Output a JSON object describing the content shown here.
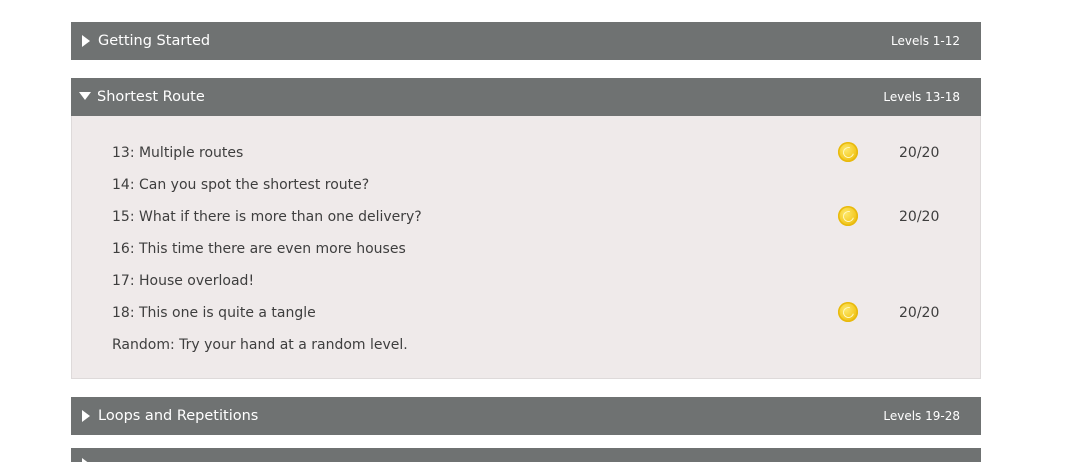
{
  "sections": [
    {
      "title": "Getting Started",
      "levels": "Levels 1-12",
      "expanded": false
    },
    {
      "title": "Shortest Route",
      "levels": "Levels 13-18",
      "expanded": true,
      "items": [
        {
          "name": "13: Multiple routes",
          "coin": true,
          "score": "20/20"
        },
        {
          "name": "14: Can you spot the shortest route?",
          "coin": false,
          "score": ""
        },
        {
          "name": "15: What if there is more than one delivery?",
          "coin": true,
          "score": "20/20"
        },
        {
          "name": "16: This time there are even more houses",
          "coin": false,
          "score": ""
        },
        {
          "name": "17: House overload!",
          "coin": false,
          "score": ""
        },
        {
          "name": "18: This one is quite a tangle",
          "coin": true,
          "score": "20/20"
        },
        {
          "name": "Random: Try your hand at a random level.",
          "coin": false,
          "score": ""
        }
      ]
    },
    {
      "title": "Loops and Repetitions",
      "levels": "Levels 19-28",
      "expanded": false
    }
  ],
  "colors": {
    "header_bg": "#6f7272",
    "panel_bg": "#efeaea",
    "coin": "#f4ca24"
  },
  "icons": {
    "collapsed": "triangle-right-icon",
    "expanded": "triangle-down-icon",
    "coin": "gold-coin-icon"
  }
}
